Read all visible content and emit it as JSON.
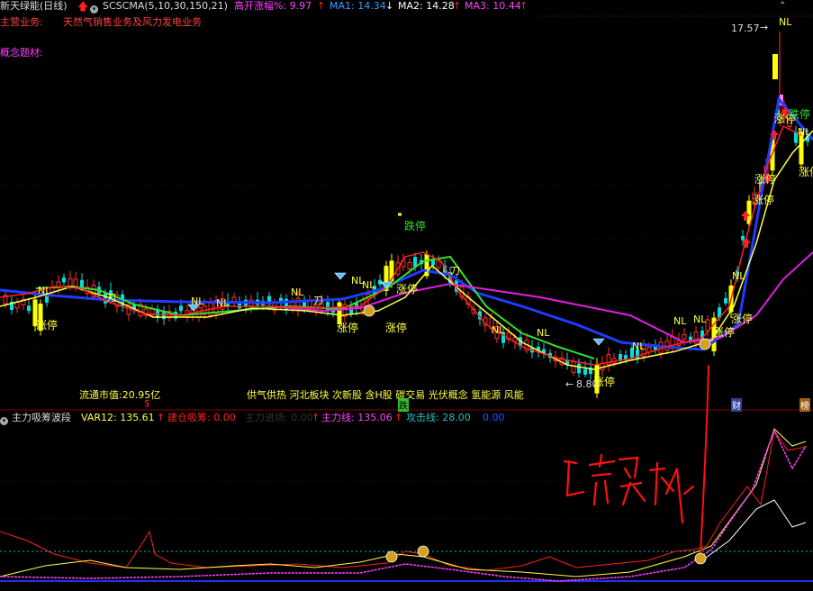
{
  "header": {
    "stock_title": "新天绿能(日线)",
    "indicator_name": "SCSCMA(5,10,30,150,21)",
    "gap_label": "高开涨幅%: 9.97",
    "ma1_label": "MA1: 14.34",
    "ma2_label": "MA2: 14.28",
    "ma3_label": "MA3: 10.44"
  },
  "info": {
    "main_business_label": "主营业务:",
    "main_business_value": "天然气销售业务及风力发电业务",
    "concept_label": "概念题材:",
    "float_value": "流通市值:20.95亿",
    "concepts": "供气供热 河北板块 次新股 含H股 碳交易 光伏概念 氢能源 风能"
  },
  "price_annotations": {
    "high_price": "17.57",
    "low_price": "8.80",
    "nl": "NL",
    "limit_up": "涨停",
    "limit_down": "跌停",
    "dao": "刀",
    "cai": "财",
    "fall": "跌",
    "bang": "榜"
  },
  "subpanel": {
    "title": "主力吸筹波段",
    "var12": "VAR12: 135.61",
    "build": "建仓吸筹: 0.00",
    "hidden": "主力进场: 0.00",
    "main_line": "主力线: 135.06",
    "attack_line": "攻击线: 28.00",
    "zero": "0.00"
  },
  "handwriting": "上穿买入",
  "colors": {
    "up": "#ff3030",
    "down": "#00e0e0",
    "yellow_bar": "#ffff00",
    "ma_blue": "#2040ff",
    "ma_green": "#30e030",
    "ma_magenta": "#e020e0",
    "ma_red": "#ff2020",
    "ma_yellow": "#ffff40",
    "gap_color": "#ff40ff",
    "ma1_color": "#30a0ff",
    "ma2_color": "#ffffff",
    "ma3_color": "#ff40ff"
  }
}
